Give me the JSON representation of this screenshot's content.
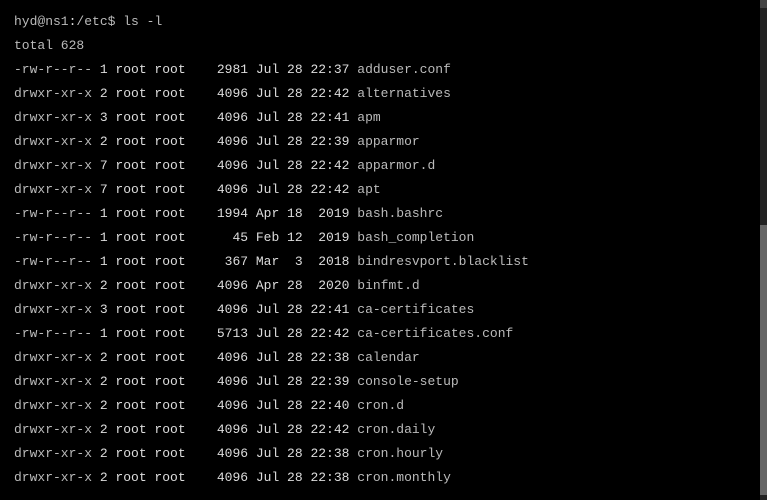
{
  "prompt": {
    "user_host": "hyd@ns1",
    "colon": ":",
    "path": "/etc",
    "dollar": "$ ",
    "command": "ls -l"
  },
  "total_line": "total 628",
  "rows": [
    {
      "perm": "-rw-r--r--",
      "links": "1",
      "owner": "root",
      "group": "root",
      "size": "2981",
      "month": "Jul",
      "day": "28",
      "time": "22:37",
      "name": "adduser.conf",
      "isdir": false
    },
    {
      "perm": "drwxr-xr-x",
      "links": "2",
      "owner": "root",
      "group": "root",
      "size": "4096",
      "month": "Jul",
      "day": "28",
      "time": "22:42",
      "name": "alternatives",
      "isdir": true
    },
    {
      "perm": "drwxr-xr-x",
      "links": "3",
      "owner": "root",
      "group": "root",
      "size": "4096",
      "month": "Jul",
      "day": "28",
      "time": "22:41",
      "name": "apm",
      "isdir": true
    },
    {
      "perm": "drwxr-xr-x",
      "links": "2",
      "owner": "root",
      "group": "root",
      "size": "4096",
      "month": "Jul",
      "day": "28",
      "time": "22:39",
      "name": "apparmor",
      "isdir": true
    },
    {
      "perm": "drwxr-xr-x",
      "links": "7",
      "owner": "root",
      "group": "root",
      "size": "4096",
      "month": "Jul",
      "day": "28",
      "time": "22:42",
      "name": "apparmor.d",
      "isdir": true
    },
    {
      "perm": "drwxr-xr-x",
      "links": "7",
      "owner": "root",
      "group": "root",
      "size": "4096",
      "month": "Jul",
      "day": "28",
      "time": "22:42",
      "name": "apt",
      "isdir": true
    },
    {
      "perm": "-rw-r--r--",
      "links": "1",
      "owner": "root",
      "group": "root",
      "size": "1994",
      "month": "Apr",
      "day": "18",
      "time": " 2019",
      "name": "bash.bashrc",
      "isdir": false
    },
    {
      "perm": "-rw-r--r--",
      "links": "1",
      "owner": "root",
      "group": "root",
      "size": "45",
      "month": "Feb",
      "day": "12",
      "time": " 2019",
      "name": "bash_completion",
      "isdir": false
    },
    {
      "perm": "-rw-r--r--",
      "links": "1",
      "owner": "root",
      "group": "root",
      "size": "367",
      "month": "Mar",
      "day": " 3",
      "time": " 2018",
      "name": "bindresvport.blacklist",
      "isdir": false
    },
    {
      "perm": "drwxr-xr-x",
      "links": "2",
      "owner": "root",
      "group": "root",
      "size": "4096",
      "month": "Apr",
      "day": "28",
      "time": " 2020",
      "name": "binfmt.d",
      "isdir": true
    },
    {
      "perm": "drwxr-xr-x",
      "links": "3",
      "owner": "root",
      "group": "root",
      "size": "4096",
      "month": "Jul",
      "day": "28",
      "time": "22:41",
      "name": "ca-certificates",
      "isdir": true
    },
    {
      "perm": "-rw-r--r--",
      "links": "1",
      "owner": "root",
      "group": "root",
      "size": "5713",
      "month": "Jul",
      "day": "28",
      "time": "22:42",
      "name": "ca-certificates.conf",
      "isdir": false
    },
    {
      "perm": "drwxr-xr-x",
      "links": "2",
      "owner": "root",
      "group": "root",
      "size": "4096",
      "month": "Jul",
      "day": "28",
      "time": "22:38",
      "name": "calendar",
      "isdir": true
    },
    {
      "perm": "drwxr-xr-x",
      "links": "2",
      "owner": "root",
      "group": "root",
      "size": "4096",
      "month": "Jul",
      "day": "28",
      "time": "22:39",
      "name": "console-setup",
      "isdir": true
    },
    {
      "perm": "drwxr-xr-x",
      "links": "2",
      "owner": "root",
      "group": "root",
      "size": "4096",
      "month": "Jul",
      "day": "28",
      "time": "22:40",
      "name": "cron.d",
      "isdir": true
    },
    {
      "perm": "drwxr-xr-x",
      "links": "2",
      "owner": "root",
      "group": "root",
      "size": "4096",
      "month": "Jul",
      "day": "28",
      "time": "22:42",
      "name": "cron.daily",
      "isdir": true
    },
    {
      "perm": "drwxr-xr-x",
      "links": "2",
      "owner": "root",
      "group": "root",
      "size": "4096",
      "month": "Jul",
      "day": "28",
      "time": "22:38",
      "name": "cron.hourly",
      "isdir": true
    },
    {
      "perm": "drwxr-xr-x",
      "links": "2",
      "owner": "root",
      "group": "root",
      "size": "4096",
      "month": "Jul",
      "day": "28",
      "time": "22:38",
      "name": "cron.monthly",
      "isdir": true
    }
  ]
}
